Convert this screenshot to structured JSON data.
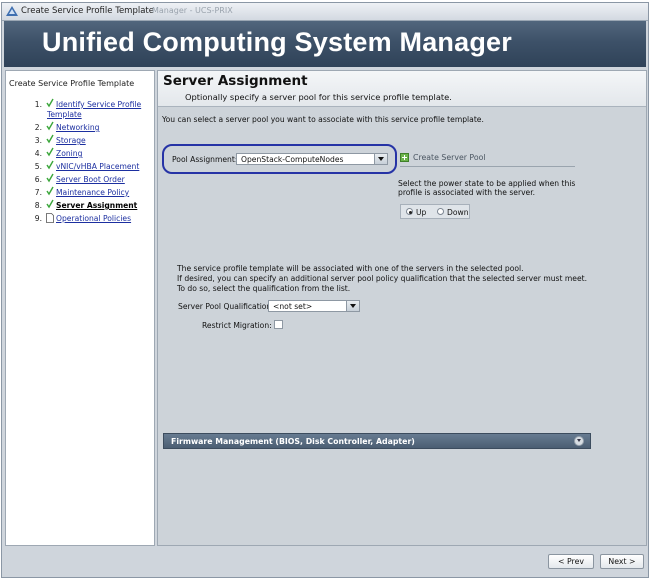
{
  "window": {
    "title": "Create Service Profile Template",
    "title_suffix": "Manager - UCS-PRIX",
    "banner_title": "Unified Computing System Manager"
  },
  "nav": {
    "heading": "Create Service Profile Template",
    "items": [
      {
        "num": "1.",
        "label": "Identify Service Profile",
        "label2": "Template",
        "state": "done"
      },
      {
        "num": "2.",
        "label": "Networking",
        "state": "done"
      },
      {
        "num": "3.",
        "label": "Storage",
        "state": "done"
      },
      {
        "num": "4.",
        "label": "Zoning",
        "state": "done"
      },
      {
        "num": "5.",
        "label": "vNIC/vHBA Placement",
        "state": "done"
      },
      {
        "num": "6.",
        "label": "Server Boot Order",
        "state": "done"
      },
      {
        "num": "7.",
        "label": "Maintenance Policy",
        "state": "done"
      },
      {
        "num": "8.",
        "label": "Server Assignment",
        "state": "current"
      },
      {
        "num": "9.",
        "label": "Operational Policies",
        "state": "pending"
      }
    ]
  },
  "main": {
    "title": "Server Assignment",
    "subtitle": "Optionally specify a server pool for this service profile template.",
    "intro": "You can select a server pool you want to associate with this service profile template.",
    "pool_label": "Pool Assignment:",
    "pool_value": "OpenStack-ComputeNodes",
    "create_pool": "Create Server Pool",
    "power_text_1": "Select the power state to be applied when this",
    "power_text_2": "profile is associated with the server.",
    "power_up": "Up",
    "power_down": "Down",
    "power_selected": "Up",
    "assoc_line_1": "The service profile template will be associated with one of the servers in the selected pool.",
    "assoc_line_2": "If desired, you can specify an additional server pool policy qualification that the selected server must meet.",
    "assoc_line_3": "To do so, select the qualification from the list.",
    "qual_label": "Server Pool Qualification:",
    "qual_value": "<not set>",
    "restrict_label": "Restrict Migration:",
    "restrict_checked": false,
    "firmware_label": "Firmware Management (BIOS, Disk Controller, Adapter)"
  },
  "footer": {
    "prev": "< Prev",
    "next": "Next >"
  },
  "colors": {
    "banner": "#3d5168",
    "highlight_oval": "#2633a6",
    "link": "#1c2fa0",
    "check": "#3aa63a"
  }
}
